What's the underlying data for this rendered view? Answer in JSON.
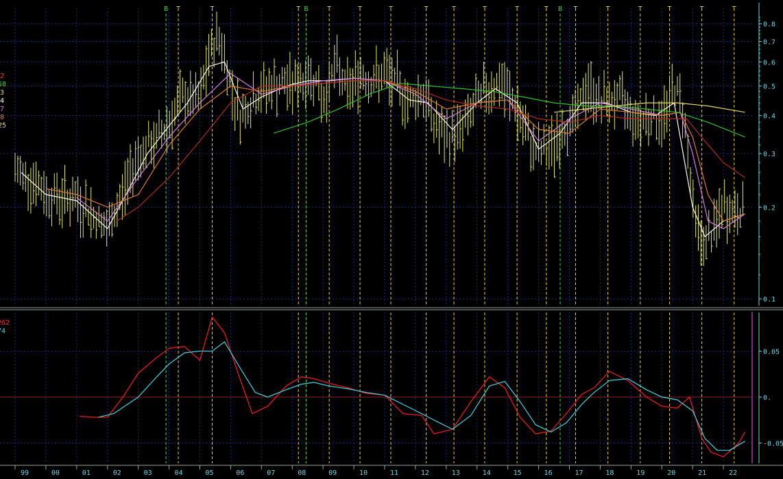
{
  "colors": {
    "background": "#000000",
    "grid": "#1c2a8c",
    "axis_text": "#6fd7e8",
    "price": "#e7ec5a",
    "ma_white": "#ffffff",
    "ma_violet": "#d77be6",
    "ma_darkred": "#b52a1e",
    "ma_orange": "#e07a2c",
    "ma_green": "#2ec42e",
    "ma_yellow": "#e3d86a",
    "marker_T": "#e7d13b",
    "marker_B": "#47d447",
    "osc_fast": "#ff1a1a",
    "osc_slow": "#3fd7e6",
    "zero_line": "#8c1a1a",
    "panel_border": "#9aa7a0",
    "right_border": "#a23ca6"
  },
  "upper_legend": [
    {
      "text": "2",
      "color": "#ff3030"
    },
    {
      "text": "58",
      "color": "#33d633"
    },
    {
      "text": "3",
      "color": "#e3d86a"
    },
    {
      "text": "4",
      "color": "#ffffff"
    },
    {
      "text": "7",
      "color": "#d77be6"
    },
    {
      "text": "8",
      "color": "#e07a2c"
    },
    {
      "text": "25",
      "color": "#e3d86a"
    }
  ],
  "lower_legend": [
    {
      "text": "262",
      "color": "#ff3030"
    },
    {
      "text": "74",
      "color": "#3fd7e6"
    }
  ],
  "markers": [
    {
      "label": "B",
      "year": 2003.9
    },
    {
      "label": "T",
      "year": 2004.3
    },
    {
      "label": "T",
      "year": 2005.4
    },
    {
      "label": "T",
      "year": 2008.2
    },
    {
      "label": "B",
      "year": 2008.45
    },
    {
      "label": "T",
      "year": 2009.2
    },
    {
      "label": "T",
      "year": 2010.2
    },
    {
      "label": "T",
      "year": 2011.2
    },
    {
      "label": "T",
      "year": 2012.35
    },
    {
      "label": "T",
      "year": 2013.25
    },
    {
      "label": "T",
      "year": 2014.25
    },
    {
      "label": "T",
      "year": 2015.3
    },
    {
      "label": "T",
      "year": 2016.25
    },
    {
      "label": "B",
      "year": 2016.7
    },
    {
      "label": "T",
      "year": 2017.2
    },
    {
      "label": "T",
      "year": 2018.25
    },
    {
      "label": "T",
      "year": 2019.3
    },
    {
      "label": "T",
      "year": 2020.25
    },
    {
      "label": "T",
      "year": 2021.3
    },
    {
      "label": "T",
      "year": 2022.35
    }
  ],
  "chart_data": [
    {
      "type": "line",
      "panel": "price",
      "y_scale": "log",
      "ylim": [
        0.095,
        0.9
      ],
      "xlim": [
        1999.0,
        2023.0
      ],
      "y_ticks": [
        {
          "value": 0.8,
          "label": "0.8"
        },
        {
          "value": 0.7,
          "label": "0.7"
        },
        {
          "value": 0.6,
          "label": "0.6"
        },
        {
          "value": 0.5,
          "label": "0.5"
        },
        {
          "value": 0.4,
          "label": "0.4"
        },
        {
          "value": 0.3,
          "label": "0.3"
        },
        {
          "value": 0.2,
          "label": "0.2"
        },
        {
          "value": 0.1,
          "label": "0.1"
        }
      ],
      "price_bars_series": {
        "x": [
          1999.0,
          1999.5,
          2000.0,
          2000.5,
          2001.0,
          2001.5,
          2002.0,
          2002.5,
          2003.0,
          2003.5,
          2004.0,
          2004.5,
          2005.0,
          2005.3,
          2005.6,
          2006.0,
          2006.3,
          2006.8,
          2007.3,
          2007.8,
          2008.3,
          2008.7,
          2009.0,
          2009.4,
          2009.8,
          2010.2,
          2010.6,
          2011.0,
          2011.4,
          2011.8,
          2012.2,
          2012.6,
          2013.0,
          2013.5,
          2014.0,
          2014.4,
          2014.8,
          2015.2,
          2015.6,
          2016.0,
          2016.4,
          2016.8,
          2017.2,
          2017.6,
          2018.0,
          2018.4,
          2018.8,
          2019.2,
          2019.6,
          2020.0,
          2020.4,
          2020.7,
          2021.0,
          2021.3,
          2021.6,
          2022.0,
          2022.4,
          2022.7
        ],
        "values": [
          0.26,
          0.25,
          0.22,
          0.215,
          0.21,
          0.19,
          0.165,
          0.22,
          0.3,
          0.32,
          0.38,
          0.46,
          0.44,
          0.62,
          0.74,
          0.5,
          0.4,
          0.46,
          0.5,
          0.5,
          0.52,
          0.54,
          0.44,
          0.58,
          0.48,
          0.55,
          0.52,
          0.54,
          0.5,
          0.44,
          0.48,
          0.38,
          0.33,
          0.36,
          0.44,
          0.5,
          0.5,
          0.44,
          0.34,
          0.3,
          0.31,
          0.36,
          0.4,
          0.5,
          0.44,
          0.45,
          0.44,
          0.38,
          0.4,
          0.38,
          0.5,
          0.42,
          0.2,
          0.15,
          0.16,
          0.2,
          0.19,
          0.2
        ]
      },
      "series": [
        {
          "key": "ma_white",
          "x": [
            1999.2,
            2000.0,
            2001.0,
            2002.0,
            2002.6,
            2003.3,
            2004.0,
            2004.6,
            2005.3,
            2005.8,
            2006.4,
            2007.0,
            2007.8,
            2008.5,
            2009.2,
            2010.0,
            2011.0,
            2011.8,
            2012.4,
            2013.2,
            2014.0,
            2014.6,
            2015.3,
            2016.0,
            2016.7,
            2017.4,
            2018.2,
            2019.0,
            2019.8,
            2020.4,
            2021.0,
            2021.4,
            2022.0,
            2022.7
          ],
          "values": [
            0.26,
            0.22,
            0.21,
            0.17,
            0.22,
            0.3,
            0.37,
            0.44,
            0.58,
            0.6,
            0.42,
            0.46,
            0.5,
            0.52,
            0.52,
            0.53,
            0.52,
            0.45,
            0.44,
            0.36,
            0.44,
            0.49,
            0.44,
            0.31,
            0.35,
            0.44,
            0.44,
            0.41,
            0.4,
            0.44,
            0.2,
            0.16,
            0.18,
            0.19
          ]
        },
        {
          "key": "ma_violet",
          "x": [
            2001.0,
            2002.0,
            2003.0,
            2004.0,
            2005.0,
            2006.0,
            2007.0,
            2008.0,
            2009.0,
            2010.0,
            2011.0,
            2012.0,
            2013.0,
            2014.0,
            2015.0,
            2016.0,
            2017.0,
            2018.0,
            2019.0,
            2020.0,
            2020.6,
            2021.0,
            2021.5,
            2022.0,
            2022.7
          ],
          "values": [
            0.215,
            0.18,
            0.25,
            0.34,
            0.44,
            0.55,
            0.47,
            0.5,
            0.52,
            0.53,
            0.52,
            0.47,
            0.39,
            0.44,
            0.45,
            0.33,
            0.39,
            0.44,
            0.42,
            0.4,
            0.41,
            0.3,
            0.18,
            0.17,
            0.19
          ]
        },
        {
          "key": "ma_orange",
          "x": [
            2000.0,
            2001.0,
            2002.0,
            2003.0,
            2004.0,
            2005.0,
            2006.0,
            2007.0,
            2008.0,
            2009.0,
            2010.0,
            2011.0,
            2012.0,
            2013.0,
            2014.0,
            2015.0,
            2016.0,
            2017.0,
            2018.0,
            2019.0,
            2020.0,
            2020.6,
            2021.0,
            2021.5,
            2022.0,
            2022.7
          ],
          "values": [
            0.23,
            0.22,
            0.2,
            0.22,
            0.32,
            0.42,
            0.5,
            0.48,
            0.5,
            0.51,
            0.52,
            0.52,
            0.48,
            0.42,
            0.44,
            0.45,
            0.36,
            0.35,
            0.42,
            0.41,
            0.4,
            0.41,
            0.34,
            0.22,
            0.18,
            0.19
          ]
        },
        {
          "key": "ma_darkred",
          "x": [
            2002.3,
            2003.0,
            2004.0,
            2005.0,
            2006.0,
            2007.0,
            2008.0,
            2009.0,
            2010.0,
            2011.0,
            2012.0,
            2013.0,
            2014.0,
            2015.0,
            2016.0,
            2017.0,
            2018.0,
            2019.0,
            2020.0,
            2020.8,
            2021.4,
            2022.0,
            2022.7
          ],
          "values": [
            0.18,
            0.2,
            0.25,
            0.33,
            0.44,
            0.5,
            0.5,
            0.51,
            0.52,
            0.52,
            0.49,
            0.45,
            0.43,
            0.42,
            0.39,
            0.38,
            0.4,
            0.39,
            0.39,
            0.39,
            0.33,
            0.28,
            0.25
          ]
        },
        {
          "key": "ma_green",
          "x": [
            2007.4,
            2008.5,
            2009.5,
            2010.5,
            2011.5,
            2012.5,
            2013.5,
            2014.5,
            2015.5,
            2016.5,
            2017.5,
            2018.5,
            2019.5,
            2020.5,
            2021.5,
            2022.7
          ],
          "values": [
            0.35,
            0.38,
            0.42,
            0.47,
            0.51,
            0.5,
            0.49,
            0.48,
            0.46,
            0.44,
            0.43,
            0.43,
            0.42,
            0.41,
            0.38,
            0.34
          ]
        },
        {
          "key": "ma_yellow",
          "x": [
            2016.5,
            2017.5,
            2018.5,
            2019.5,
            2020.5,
            2021.5,
            2022.7
          ],
          "values": [
            0.41,
            0.42,
            0.43,
            0.44,
            0.44,
            0.43,
            0.41
          ]
        }
      ]
    },
    {
      "type": "line",
      "panel": "oscillator",
      "ylim": [
        -0.072,
        0.092
      ],
      "xlim": [
        1999.0,
        2023.0
      ],
      "y_ticks": [
        {
          "value": 0.05,
          "label": "0.05"
        },
        {
          "value": 0.0,
          "label": "0."
        },
        {
          "value": -0.05,
          "label": "-0.05"
        }
      ],
      "series": [
        {
          "key": "osc_fast",
          "x": [
            2001.1,
            2001.6,
            2002.0,
            2002.5,
            2003.0,
            2003.6,
            2004.0,
            2004.5,
            2005.0,
            2005.4,
            2005.8,
            2006.3,
            2006.7,
            2007.2,
            2007.8,
            2008.3,
            2008.7,
            2009.2,
            2009.8,
            2010.4,
            2011.0,
            2011.6,
            2012.2,
            2012.6,
            2013.2,
            2013.8,
            2014.4,
            2014.9,
            2015.4,
            2015.9,
            2016.4,
            2016.9,
            2017.4,
            2017.8,
            2018.3,
            2018.9,
            2019.5,
            2020.0,
            2020.5,
            2020.9,
            2021.3,
            2021.6,
            2022.0,
            2022.5,
            2022.7
          ],
          "values": [
            -0.021,
            -0.022,
            -0.022,
            0.0,
            0.026,
            0.043,
            0.053,
            0.055,
            0.04,
            0.087,
            0.07,
            0.02,
            -0.018,
            -0.01,
            0.012,
            0.022,
            0.02,
            0.015,
            0.01,
            0.004,
            0.002,
            -0.018,
            -0.02,
            -0.04,
            -0.035,
            -0.005,
            0.022,
            0.01,
            -0.022,
            -0.04,
            -0.037,
            -0.018,
            0.003,
            0.01,
            0.028,
            0.018,
            0.0,
            -0.01,
            -0.012,
            0.0,
            -0.045,
            -0.06,
            -0.065,
            -0.05,
            -0.038
          ]
        },
        {
          "key": "osc_slow",
          "x": [
            2001.7,
            2002.2,
            2003.0,
            2003.6,
            2004.0,
            2004.5,
            2005.0,
            2005.4,
            2005.8,
            2006.3,
            2006.8,
            2007.2,
            2007.8,
            2008.3,
            2008.7,
            2009.2,
            2009.8,
            2010.4,
            2011.0,
            2011.6,
            2012.2,
            2012.6,
            2013.2,
            2013.8,
            2014.4,
            2014.9,
            2015.4,
            2015.9,
            2016.4,
            2016.9,
            2017.4,
            2017.8,
            2018.3,
            2018.9,
            2019.5,
            2020.0,
            2020.5,
            2021.0,
            2021.4,
            2021.8,
            2022.2,
            2022.7
          ],
          "values": [
            -0.022,
            -0.018,
            0.0,
            0.022,
            0.036,
            0.048,
            0.05,
            0.05,
            0.06,
            0.032,
            0.005,
            0.0,
            0.008,
            0.014,
            0.016,
            0.012,
            0.009,
            0.005,
            0.002,
            -0.008,
            -0.018,
            -0.025,
            -0.035,
            -0.02,
            0.012,
            0.017,
            -0.005,
            -0.03,
            -0.038,
            -0.028,
            -0.008,
            0.005,
            0.018,
            0.02,
            0.008,
            0.0,
            -0.003,
            -0.015,
            -0.045,
            -0.058,
            -0.058,
            -0.048
          ]
        }
      ]
    }
  ],
  "x_axis": {
    "ticks": [
      {
        "year": 1999.0,
        "label": "99"
      },
      {
        "year": 2000.0,
        "label": "00"
      },
      {
        "year": 2001.0,
        "label": "01"
      },
      {
        "year": 2002.0,
        "label": "02"
      },
      {
        "year": 2003.0,
        "label": "03"
      },
      {
        "year": 2004.0,
        "label": "04"
      },
      {
        "year": 2005.0,
        "label": "05"
      },
      {
        "year": 2006.0,
        "label": "06"
      },
      {
        "year": 2007.0,
        "label": "07"
      },
      {
        "year": 2008.0,
        "label": "08"
      },
      {
        "year": 2009.0,
        "label": "09"
      },
      {
        "year": 2010.0,
        "label": "10"
      },
      {
        "year": 2011.0,
        "label": "11"
      },
      {
        "year": 2012.0,
        "label": "12"
      },
      {
        "year": 2013.0,
        "label": "13"
      },
      {
        "year": 2014.0,
        "label": "14"
      },
      {
        "year": 2015.0,
        "label": "15"
      },
      {
        "year": 2016.0,
        "label": "16"
      },
      {
        "year": 2017.0,
        "label": "17"
      },
      {
        "year": 2018.0,
        "label": "18"
      },
      {
        "year": 2019.0,
        "label": "19"
      },
      {
        "year": 2020.0,
        "label": "20"
      },
      {
        "year": 2021.0,
        "label": "21"
      },
      {
        "year": 2022.0,
        "label": "22"
      }
    ]
  }
}
